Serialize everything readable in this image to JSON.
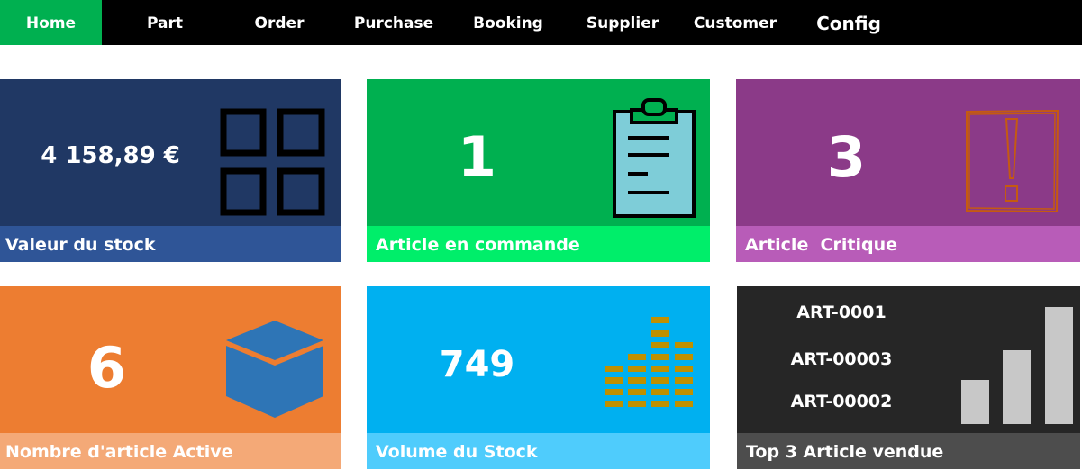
{
  "nav": {
    "items": [
      "Home",
      "Part",
      "Order",
      "Purchase",
      "Booking",
      "Supplier",
      "Customer",
      "Config"
    ],
    "active_index": 0
  },
  "tiles": {
    "stock_value": {
      "value": "4 158,89 €",
      "label": "Valeur du stock",
      "icon": "grid-icon"
    },
    "ordered": {
      "value": "1",
      "label": "Article en commande",
      "icon": "clipboard-icon"
    },
    "critical": {
      "value": "3",
      "label": "Article  Critique",
      "icon": "warning-icon"
    },
    "active": {
      "value": "6",
      "label": "Nombre d'article Active",
      "icon": "box-icon"
    },
    "volume": {
      "value": "749",
      "label": "Volume du Stock",
      "icon": "equalizer-icon"
    },
    "top3": {
      "label": "Top 3 Article vendue",
      "items": [
        "ART-0001",
        "ART-00003",
        "ART-00002"
      ],
      "icon": "bar-chart-icon"
    }
  },
  "colors": {
    "nav_bg": "#000000",
    "nav_active": "#00b050",
    "navy": "#203864",
    "navy_band": "#2f5597",
    "green": "#00b050",
    "green_band": "#00ee6a",
    "purple": "#8b3a88",
    "purple_band": "#b85cb8",
    "orange": "#ed7d31",
    "orange_band": "#f4a977",
    "sky": "#00b0f0",
    "sky_band": "#4fccfc",
    "dark": "#262626",
    "dark_band": "#4d4d4d"
  }
}
